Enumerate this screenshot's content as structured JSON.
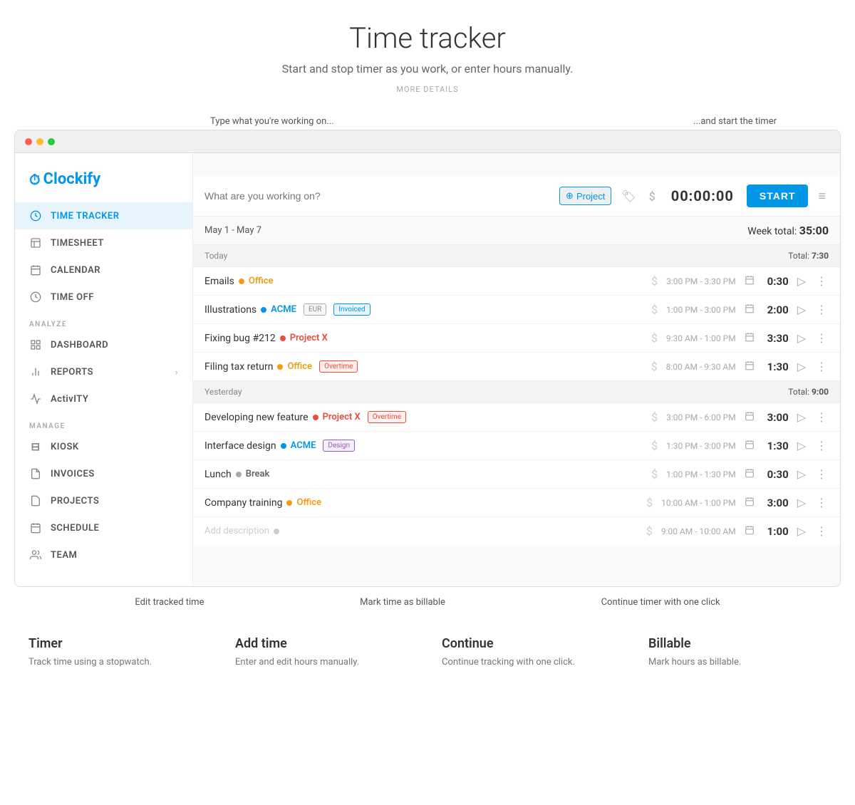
{
  "header": {
    "title": "Time tracker",
    "subtitle": "Start and stop timer as you work, or enter hours manually.",
    "link": "MORE DETAILS"
  },
  "top_annotations": {
    "left": "Type what you're working on...",
    "right": "...and start the timer"
  },
  "logo": {
    "text": "Clockify"
  },
  "sidebar": {
    "nav_items": [
      {
        "id": "time-tracker",
        "label": "TIME TRACKER",
        "icon": "⏱",
        "active": true
      },
      {
        "id": "timesheet",
        "label": "TIMESHEET",
        "icon": "📋",
        "active": false
      },
      {
        "id": "calendar",
        "label": "CALENDAR",
        "icon": "📅",
        "active": false
      },
      {
        "id": "time-off",
        "label": "TIME OFF",
        "icon": "⏰",
        "active": false
      }
    ],
    "analyze_label": "ANALYZE",
    "analyze_items": [
      {
        "id": "dashboard",
        "label": "DASHBOARD",
        "icon": "⊞",
        "active": false
      },
      {
        "id": "reports",
        "label": "REPORTS",
        "icon": "📊",
        "active": false,
        "arrow": "›"
      },
      {
        "id": "activity",
        "label": "ActivITY",
        "icon": "📈",
        "active": false
      }
    ],
    "manage_label": "MANAGE",
    "manage_items": [
      {
        "id": "kiosk",
        "label": "KIOSK",
        "icon": "⊟",
        "active": false
      },
      {
        "id": "invoices",
        "label": "INVOICES",
        "icon": "📄",
        "active": false
      },
      {
        "id": "projects",
        "label": "PROJECTS",
        "icon": "📝",
        "active": false
      },
      {
        "id": "schedule",
        "label": "SCHEDULE",
        "icon": "⊟",
        "active": false
      },
      {
        "id": "team",
        "label": "TEAM",
        "icon": "👥",
        "active": false
      }
    ]
  },
  "timer_bar": {
    "placeholder": "What are you working on?",
    "project_label": "Project",
    "time": "00:00:00",
    "start_label": "START"
  },
  "week": {
    "range": "May 1 - May 7",
    "total_label": "Week total:",
    "total": "35:00"
  },
  "today": {
    "label": "Today",
    "total_label": "Total:",
    "total": "7:30",
    "entries": [
      {
        "name": "Emails",
        "project": "Office",
        "project_class": "project-office",
        "dot_color": "#f39c12",
        "tags": [],
        "time_range": "3:00 PM - 3:30 PM",
        "duration": "0:30"
      },
      {
        "name": "Illustrations",
        "project": "ACME",
        "project_class": "project-acme",
        "dot_color": "#0097e6",
        "tags": [
          "EUR",
          "Invoiced"
        ],
        "time_range": "1:00 PM - 3:00 PM",
        "duration": "2:00"
      },
      {
        "name": "Fixing bug #212",
        "project": "Project X",
        "project_class": "project-x",
        "dot_color": "#e74c3c",
        "tags": [],
        "time_range": "9:30 AM - 1:00 PM",
        "duration": "3:30"
      },
      {
        "name": "Filing tax return",
        "project": "Office",
        "project_class": "project-office",
        "dot_color": "#f39c12",
        "tags": [
          "Overtime"
        ],
        "time_range": "8:00 AM - 9:30 AM",
        "duration": "1:30"
      }
    ]
  },
  "yesterday": {
    "label": "Yesterday",
    "total_label": "Total:",
    "total": "9:00",
    "entries": [
      {
        "name": "Developing new feature",
        "project": "Project X",
        "project_class": "project-x",
        "dot_color": "#e74c3c",
        "tags": [
          "Overtime"
        ],
        "time_range": "3:00 PM - 6:00 PM",
        "duration": "3:00"
      },
      {
        "name": "Interface design",
        "project": "ACME",
        "project_class": "project-acme",
        "dot_color": "#0097e6",
        "tags": [
          "Design"
        ],
        "time_range": "1:30 PM - 3:00 PM",
        "duration": "1:30"
      },
      {
        "name": "Lunch",
        "project": "Break",
        "project_class": "project-break",
        "dot_color": "#aaa",
        "tags": [],
        "time_range": "1:00 PM - 1:30 PM",
        "duration": "0:30"
      },
      {
        "name": "Company training",
        "project": "Office",
        "project_class": "project-office",
        "dot_color": "#f39c12",
        "tags": [],
        "time_range": "10:00 AM - 1:00 PM",
        "duration": "3:00"
      },
      {
        "name": "Add description",
        "project": "",
        "project_class": "",
        "dot_color": "#ccc",
        "tags": [],
        "time_range": "9:00 AM - 10:00 AM",
        "duration": "1:00",
        "placeholder": true
      }
    ]
  },
  "bottom_annotations": {
    "edit": "Edit tracked time",
    "billable": "Mark time as billable",
    "continue": "Continue timer with one click"
  },
  "features": [
    {
      "title": "Timer",
      "desc": "Track time using a stopwatch."
    },
    {
      "title": "Add time",
      "desc": "Enter and edit hours manually."
    },
    {
      "title": "Continue",
      "desc": "Continue tracking with one click."
    },
    {
      "title": "Billable",
      "desc": "Mark hours as billable."
    }
  ]
}
